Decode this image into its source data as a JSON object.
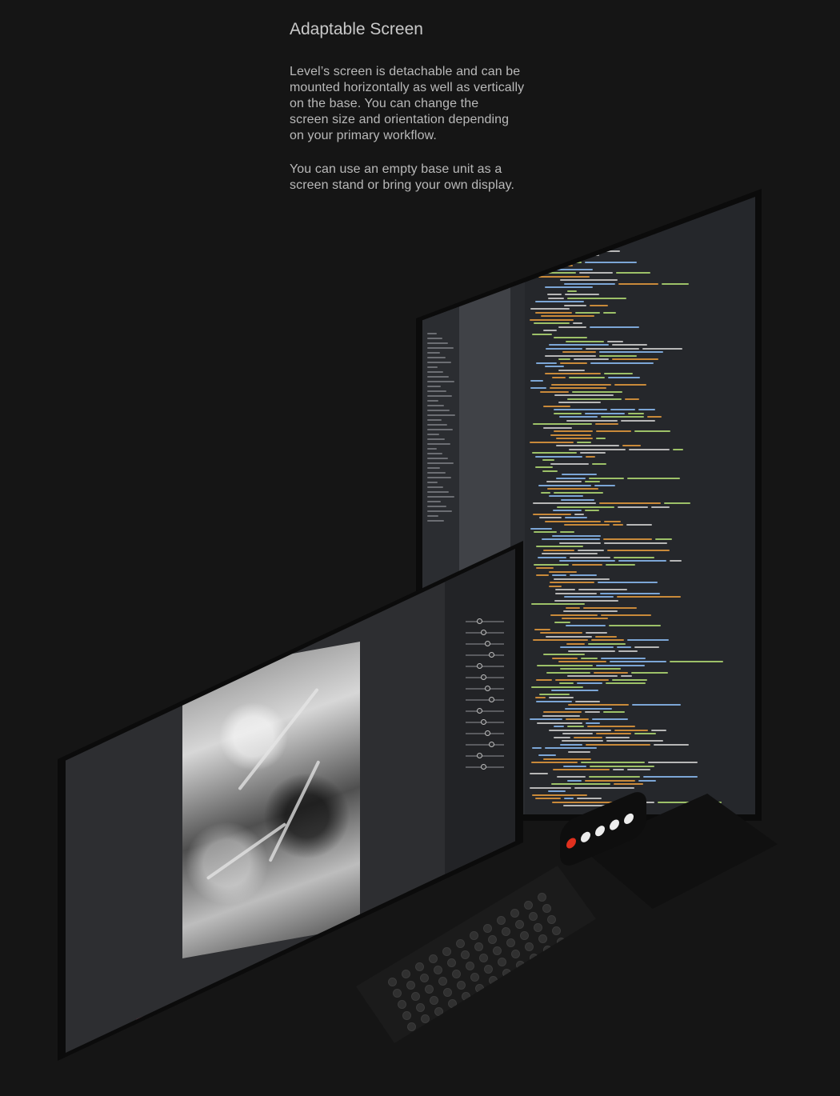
{
  "section": {
    "title": "Adaptable Screen",
    "paragraph1": "Level’s screen is detachable and can be\nmounted horizontally as well as vertically\non the base. You can change the\nscreen size and orientation depending\non your primary workflow.",
    "paragraph2": "You can use an empty base unit as a\nscreen stand or bring your own display."
  },
  "colors": {
    "background": "#151515",
    "device": "#0b0b0b",
    "code_orange": "#c98a3a",
    "code_green": "#9dc168",
    "code_blue": "#7ca6d6",
    "record_red": "#e0301e"
  }
}
